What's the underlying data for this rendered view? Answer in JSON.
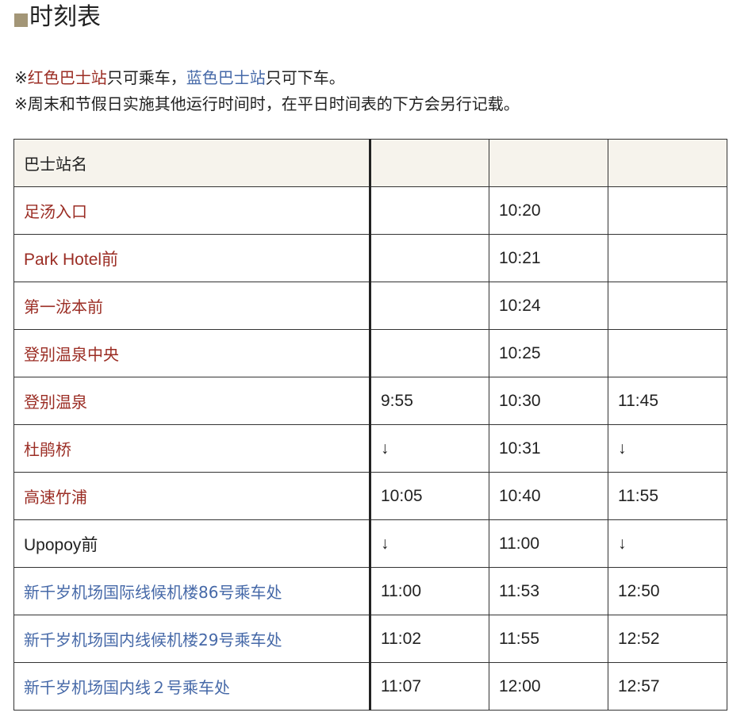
{
  "heading": {
    "marker_color": "#a39677",
    "title": "时刻表"
  },
  "notes": {
    "line1": {
      "prefix": "※",
      "red_label": "红色巴士站",
      "mid": "只可乘车，",
      "blue_label": "蓝色巴士站",
      "suffix": "只可下车。"
    },
    "line2": "※周末和节假日实施其他运行时间时，在平日时间表的下方会另行记载。"
  },
  "colors": {
    "boarding_only": "#9b2d24",
    "alighting_only": "#4669a8",
    "header_bg": "#f6f3ec"
  },
  "table": {
    "header": [
      "巴士站名",
      "",
      "",
      ""
    ],
    "rows": [
      {
        "stop": "足汤入口",
        "type": "red",
        "times": [
          "",
          "10:20",
          ""
        ]
      },
      {
        "stop": "Park Hotel前",
        "type": "red",
        "times": [
          "",
          "10:21",
          ""
        ]
      },
      {
        "stop": "第一泷本前",
        "type": "red",
        "times": [
          "",
          "10:24",
          ""
        ]
      },
      {
        "stop": "登别温泉中央",
        "type": "red",
        "times": [
          "",
          "10:25",
          ""
        ]
      },
      {
        "stop": "登别温泉",
        "type": "red",
        "times": [
          "9:55",
          "10:30",
          "11:45"
        ]
      },
      {
        "stop": "杜鹃桥",
        "type": "red",
        "times": [
          "↓",
          "10:31",
          "↓"
        ]
      },
      {
        "stop": "高速竹浦",
        "type": "red",
        "times": [
          "10:05",
          "10:40",
          "11:55"
        ]
      },
      {
        "stop": "Upopoy前",
        "type": "black",
        "times": [
          "↓",
          "11:00",
          "↓"
        ]
      },
      {
        "stop": "新千岁机场国际线候机楼86号乘车处",
        "type": "blue",
        "times": [
          "11:00",
          "11:53",
          "12:50"
        ]
      },
      {
        "stop": "新千岁机场国内线候机楼29号乘车处",
        "type": "blue",
        "times": [
          "11:02",
          "11:55",
          "12:52"
        ]
      },
      {
        "stop": "新千岁机场国内线２号乘车处",
        "type": "blue",
        "times": [
          "11:07",
          "12:00",
          "12:57"
        ]
      }
    ]
  }
}
